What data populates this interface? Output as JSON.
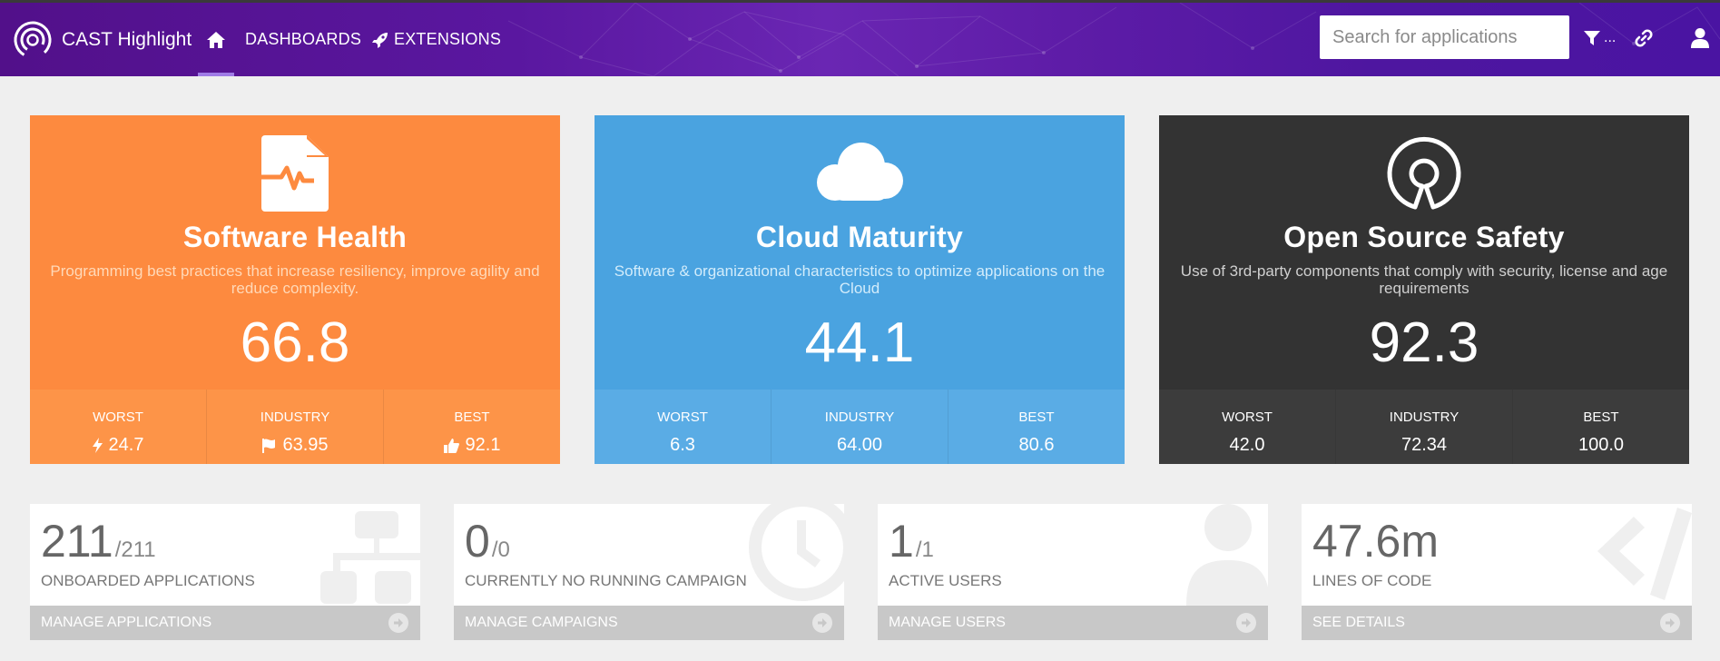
{
  "navbar": {
    "brand": "CAST Highlight",
    "home_icon": "home-icon",
    "dashboards_label": "DASHBOARDS",
    "extensions_label": "EXTENSIONS",
    "search_placeholder": "Search for applications",
    "filter_label": "...",
    "accent_color": "#5a17a0"
  },
  "cards": {
    "health": {
      "icon": "file-heartbeat-icon",
      "title": "Software Health",
      "description": "Programming best practices that increase resiliency, improve agility and reduce complexity.",
      "score": "66.8",
      "worst_label": "WORST",
      "worst": "24.7",
      "industry_label": "INDUSTRY",
      "industry": "63.95",
      "best_label": "BEST",
      "best": "92.1",
      "color": "#fd8a3f"
    },
    "cloud": {
      "icon": "cloud-icon",
      "title": "Cloud Maturity",
      "description": "Software & organizational characteristics to optimize applications on the Cloud",
      "score": "44.1",
      "worst_label": "WORST",
      "worst": "6.3",
      "industry_label": "INDUSTRY",
      "industry": "64.00",
      "best_label": "BEST",
      "best": "80.6",
      "color": "#4aa3e0"
    },
    "oss": {
      "icon": "open-source-icon",
      "title": "Open Source Safety",
      "description": "Use of 3rd-party components that comply with security, license and age requirements",
      "score": "92.3",
      "worst_label": "WORST",
      "worst": "42.0",
      "industry_label": "INDUSTRY",
      "industry": "72.34",
      "best_label": "BEST",
      "best": "100.0",
      "color": "#333333"
    }
  },
  "tiles": {
    "apps": {
      "value": "211",
      "total": "/211",
      "label": "ONBOARDED APPLICATIONS",
      "link": "MANAGE APPLICATIONS",
      "icon": "sitemap-icon"
    },
    "campaigns": {
      "value": "0",
      "total": "/0",
      "label": "CURRENTLY NO RUNNING CAMPAIGN",
      "link": "MANAGE CAMPAIGNS",
      "icon": "clock-icon"
    },
    "users": {
      "value": "1",
      "total": "/1",
      "label": "ACTIVE USERS",
      "link": "MANAGE USERS",
      "icon": "user-icon"
    },
    "loc": {
      "value": "47.6m",
      "total": "",
      "label": "LINES OF CODE",
      "link": "SEE DETAILS",
      "icon": "code-icon"
    }
  }
}
